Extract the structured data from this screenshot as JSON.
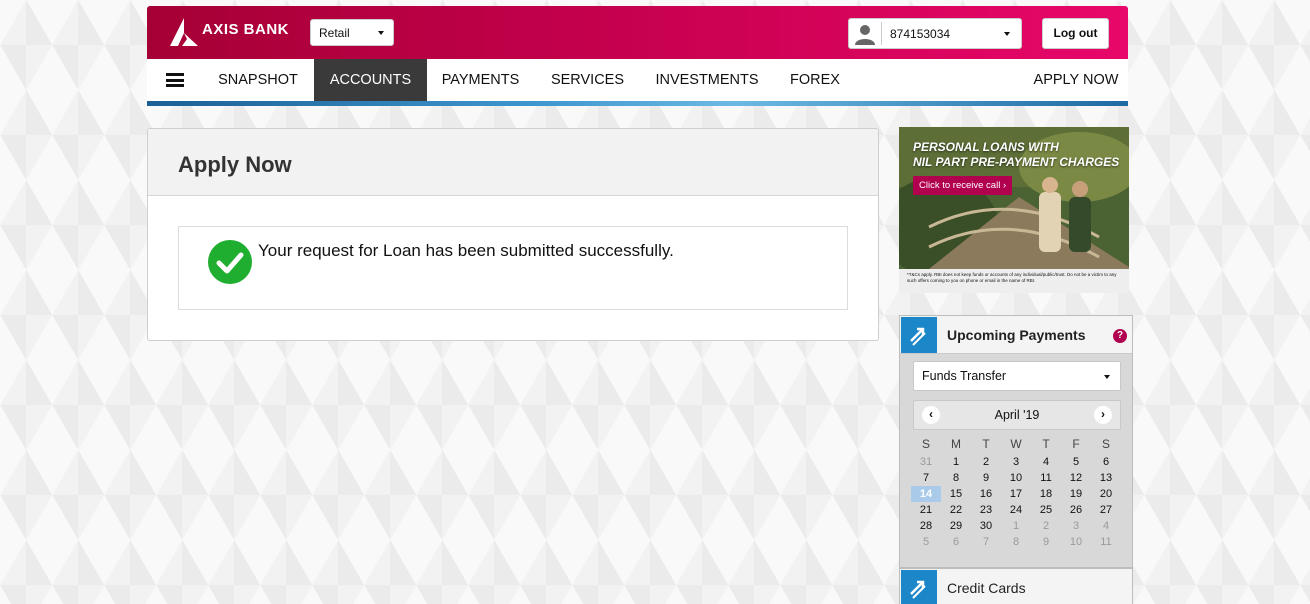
{
  "header": {
    "brand": "AXIS BANK",
    "segment_select": "Retail",
    "customer_id": "874153034",
    "logout_label": "Log out"
  },
  "nav": {
    "items": [
      "SNAPSHOT",
      "ACCOUNTS",
      "PAYMENTS",
      "SERVICES",
      "INVESTMENTS",
      "FOREX"
    ],
    "active": "ACCOUNTS",
    "apply_now": "APPLY NOW"
  },
  "main": {
    "title": "Apply Now",
    "message": "Your request for Loan has been submitted successfully."
  },
  "ad": {
    "headline_1": "PERSONAL LOANS WITH",
    "headline_2": "NIL PART PRE-PAYMENT CHARGES",
    "cta": "Click to receive call",
    "disclaimer": "*T&Cs apply. RBI does not keep funds or accounts of any individual/public/trust. Do not be a victim to any such offers coming to you on phone or email in the name of RBI."
  },
  "upcoming_payments": {
    "title": "Upcoming Payments",
    "help": "?",
    "dropdown_value": "Funds Transfer",
    "calendar": {
      "month_label": "April '19",
      "prev": "‹",
      "next": "›",
      "weekdays": [
        "S",
        "M",
        "T",
        "W",
        "T",
        "F",
        "S"
      ],
      "weeks": [
        [
          "31",
          "1",
          "2",
          "3",
          "4",
          "5",
          "6"
        ],
        [
          "7",
          "8",
          "9",
          "10",
          "11",
          "12",
          "13"
        ],
        [
          "14",
          "15",
          "16",
          "17",
          "18",
          "19",
          "20"
        ],
        [
          "21",
          "22",
          "23",
          "24",
          "25",
          "26",
          "27"
        ],
        [
          "28",
          "29",
          "30",
          "1",
          "2",
          "3",
          "4"
        ],
        [
          "5",
          "6",
          "7",
          "8",
          "9",
          "10",
          "11"
        ]
      ],
      "today": "14"
    }
  },
  "credit_cards": {
    "title": "Credit Cards"
  },
  "colors": {
    "brand": "#ae0042",
    "brand_light": "#e8076a",
    "accent_blue": "#1b86c8",
    "success": "#1fae2f"
  }
}
